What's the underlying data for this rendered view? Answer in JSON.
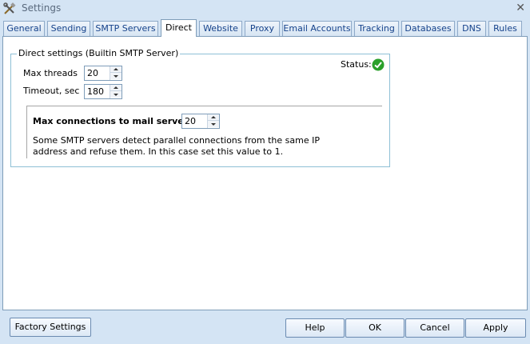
{
  "window": {
    "title": "Settings"
  },
  "tabs": [
    {
      "label": "General"
    },
    {
      "label": "Sending"
    },
    {
      "label": "SMTP Servers"
    },
    {
      "label": "Direct",
      "active": true
    },
    {
      "label": "Website"
    },
    {
      "label": "Proxy"
    },
    {
      "label": "Email Accounts"
    },
    {
      "label": "Tracking"
    },
    {
      "label": "Databases"
    },
    {
      "label": "DNS"
    },
    {
      "label": "Rules"
    }
  ],
  "direct": {
    "group_label": "Direct settings (Builtin SMTP Server)",
    "status_label": "Status:",
    "status_color": "#2aa02a",
    "max_threads": {
      "label": "Max threads",
      "value": "20"
    },
    "timeout": {
      "label": "Timeout, sec",
      "value": "180"
    },
    "max_connections": {
      "label": "Max connections to mail server",
      "value": "20"
    },
    "description_line1": "Some SMTP servers detect parallel connections from the same IP",
    "description_line2": "address  and refuse them.  In this case set this value to 1."
  },
  "buttons": {
    "factory_settings": "Factory Settings",
    "help": "Help",
    "ok": "OK",
    "cancel": "Cancel",
    "apply": "Apply"
  },
  "icons": {
    "app": "tools-icon",
    "close": "close-icon",
    "status": "check-circle-icon"
  }
}
